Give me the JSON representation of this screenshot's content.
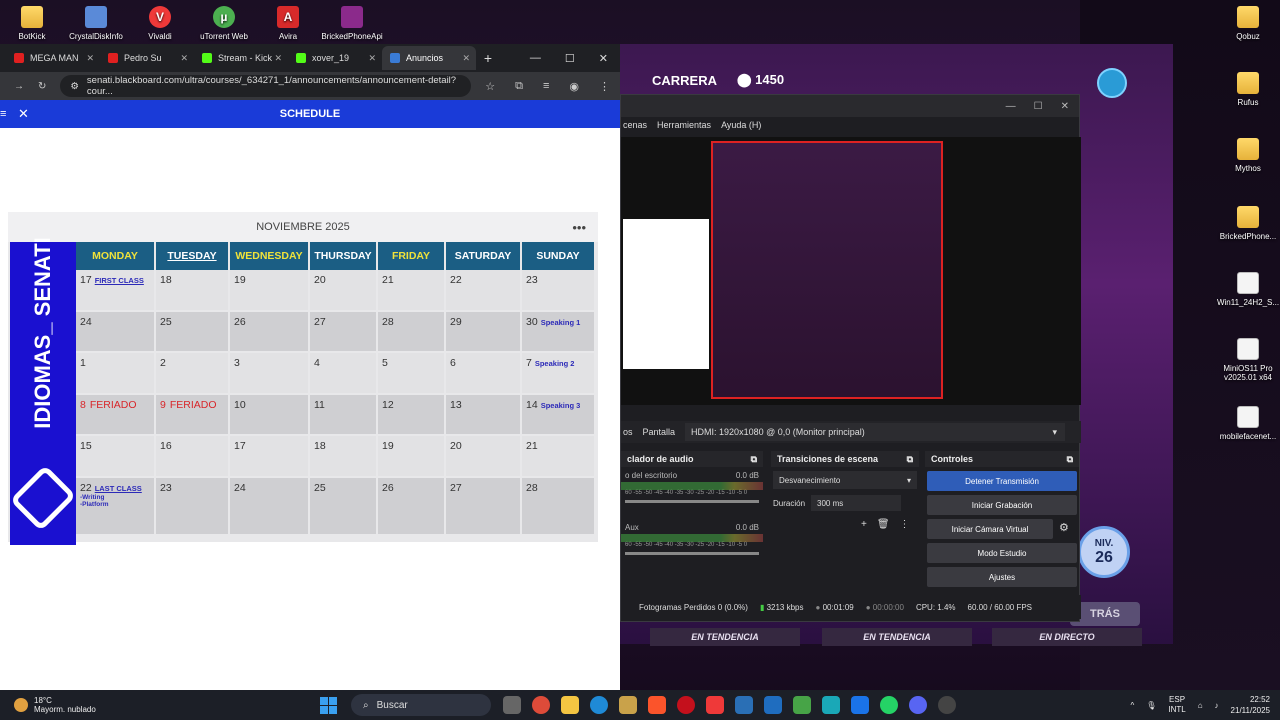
{
  "desktop": {
    "top_icons": [
      {
        "label": "BotKick",
        "icon": "folder-icon"
      },
      {
        "label": "CrystalDiskInfo",
        "icon": "disk-icon"
      },
      {
        "label": "Vivaldi",
        "icon": "vivaldi-icon"
      },
      {
        "label": "uTorrent Web",
        "icon": "utorrent-icon"
      },
      {
        "label": "Avira",
        "icon": "avira-icon"
      },
      {
        "label": "BrickedPhoneApi",
        "icon": "archive-icon"
      }
    ],
    "right_icons": [
      {
        "label": "Qobuz",
        "type": "folder"
      },
      {
        "label": "Rufus",
        "type": "folder"
      },
      {
        "label": "Mythos",
        "type": "folder"
      },
      {
        "label": "BrickedPhone...",
        "type": "folder"
      },
      {
        "label": "Win11_24H2_S...",
        "type": "file"
      },
      {
        "label": "MiniOS11 Pro v2025.01 x64",
        "type": "file"
      },
      {
        "label": "mobilefacenet...",
        "type": "file"
      }
    ]
  },
  "stream": {
    "carrera_label": "CARRERA",
    "points": "1450",
    "level_label": "NIV.",
    "level_value": "26",
    "back_label": "TRÁS",
    "ribbons": [
      "EN TENDENCIA",
      "EN TENDENCIA",
      "EN DIRECTO"
    ]
  },
  "obs": {
    "menu": [
      "cenas",
      "Herramientas",
      "Ayuda (H)"
    ],
    "source_label": "Pantalla",
    "source_value": "HDMI: 1920x1080 @ 0,0 (Monitor principal)",
    "tab_label": "os",
    "mixer_title": "clador de audio",
    "mixer": [
      {
        "name": "o del escritorio",
        "db": "0.0 dB"
      },
      {
        "name": "Aux",
        "db": "0.0 dB"
      }
    ],
    "meter_scale": "60 -55 -50 -45 -40 -35 -30 -25 -20 -15 -10 -5 0",
    "transitions_title": "Transiciones de escena",
    "transition": "Desvanecimiento",
    "duration_label": "Duración",
    "duration_value": "300 ms",
    "controls_title": "Controles",
    "controls": [
      "Detener Transmisión",
      "Iniciar Grabación",
      "Iniciar Cámara Virtual",
      "Modo Estudio",
      "Ajustes"
    ],
    "status": {
      "dropped": "Fotogramas Perdidos 0 (0.0%)",
      "bitrate": "3213 kbps",
      "live_time": "00:01:09",
      "rec_time": "00:00:00",
      "cpu": "CPU: 1.4%",
      "fps": "60.00 / 60.00 FPS"
    }
  },
  "browser": {
    "tabs": [
      {
        "label": "MEGA MAN",
        "favicon_color": "#e02020"
      },
      {
        "label": "Pedro Su",
        "favicon_color": "#e02020"
      },
      {
        "label": "Stream - Kick",
        "favicon_color": "#53fc18"
      },
      {
        "label": "xover_19",
        "favicon_color": "#53fc18"
      },
      {
        "label": "Anuncios",
        "favicon_color": "#3a7bd5",
        "active": true
      }
    ],
    "url": "senati.blackboard.com/ultra/courses/_634271_1/announcements/announcement-detail?cour...",
    "schedule_title": "SCHEDULE"
  },
  "calendar": {
    "month": "NOVIEMBRE 2025",
    "brand": "IDIOMAS_ SENATI",
    "days": [
      {
        "label": "MONDAY",
        "color": "#f0e23a"
      },
      {
        "label": "TUESDAY",
        "color": "#ffffff"
      },
      {
        "label": "WEDNESDAY",
        "color": "#f0e23a"
      },
      {
        "label": "THURSDAY",
        "color": "#ffffff"
      },
      {
        "label": "FRIDAY",
        "color": "#f0e23a"
      },
      {
        "label": "SATURDAY",
        "color": "#ffffff"
      },
      {
        "label": "SUNDAY",
        "color": "#ffffff"
      }
    ],
    "weeks": [
      [
        {
          "d": "17",
          "note": "FIRST CLASS",
          "u": true
        },
        {
          "d": "18"
        },
        {
          "d": "19"
        },
        {
          "d": "20"
        },
        {
          "d": "21"
        },
        {
          "d": "22"
        },
        {
          "d": "23"
        }
      ],
      [
        {
          "d": "24"
        },
        {
          "d": "25"
        },
        {
          "d": "26"
        },
        {
          "d": "27"
        },
        {
          "d": "28"
        },
        {
          "d": "29"
        },
        {
          "d": "30",
          "note": "Speaking 1"
        }
      ],
      [
        {
          "d": "1"
        },
        {
          "d": "2"
        },
        {
          "d": "3"
        },
        {
          "d": "4"
        },
        {
          "d": "5"
        },
        {
          "d": "6"
        },
        {
          "d": "7",
          "note": "Speaking 2"
        }
      ],
      [
        {
          "d": "8",
          "red": "FERIADO"
        },
        {
          "d": "9",
          "red": "FERIADO"
        },
        {
          "d": "10"
        },
        {
          "d": "11"
        },
        {
          "d": "12"
        },
        {
          "d": "13"
        },
        {
          "d": "14",
          "note": "Speaking 3"
        }
      ],
      [
        {
          "d": "15"
        },
        {
          "d": "16"
        },
        {
          "d": "17"
        },
        {
          "d": "18"
        },
        {
          "d": "19"
        },
        {
          "d": "20"
        },
        {
          "d": "21"
        }
      ],
      [
        {
          "d": "22",
          "note": "LAST CLASS",
          "u": true,
          "sub": [
            "-Writing",
            "-Platform"
          ]
        },
        {
          "d": "23"
        },
        {
          "d": "24"
        },
        {
          "d": "25"
        },
        {
          "d": "26"
        },
        {
          "d": "27"
        },
        {
          "d": "28"
        }
      ]
    ]
  },
  "taskbar": {
    "temp": "18°C",
    "weather": "Mayorm. nublado",
    "search_placeholder": "Buscar",
    "lang_top": "ESP",
    "lang_bottom": "INTL",
    "time": "22:52",
    "date": "21/11/2025"
  }
}
